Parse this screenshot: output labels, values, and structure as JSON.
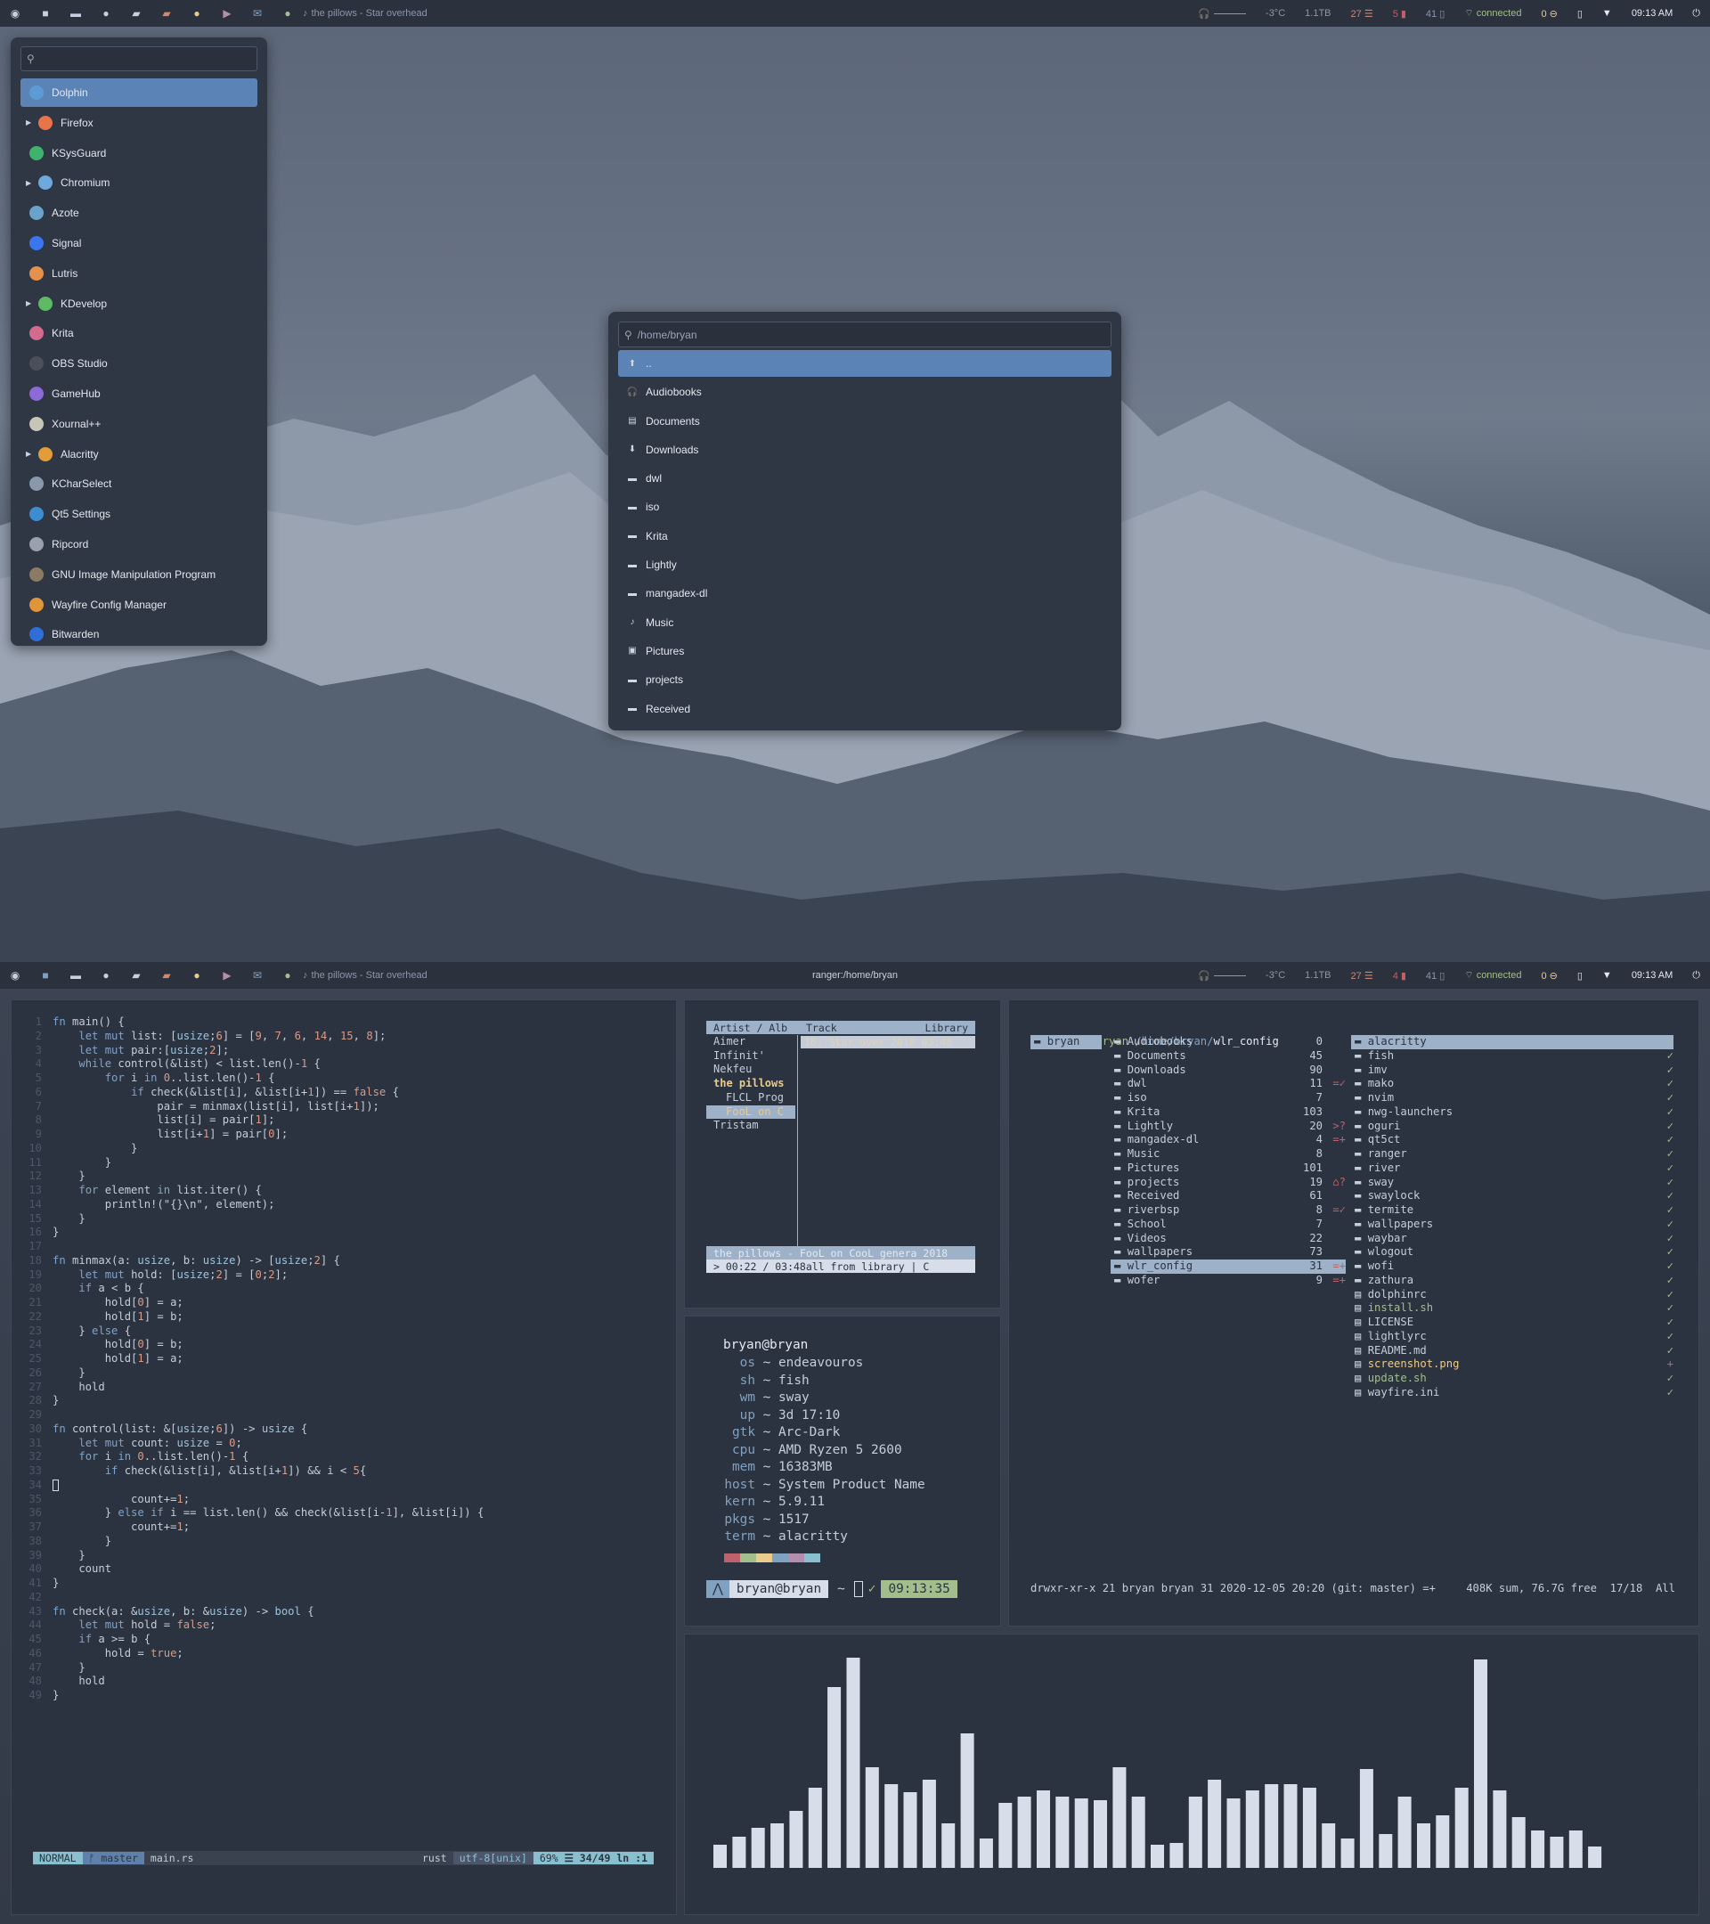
{
  "top_bar": {
    "now_playing": "the pillows - Star overhead",
    "temp": "-3°C",
    "disk": "1.1TB",
    "cpu": "27",
    "mem": "5",
    "battery": "41",
    "network": "connected",
    "notify": "0",
    "clock": "09:13 AM"
  },
  "bottom_bar": {
    "now_playing": "the pillows - Star overhead",
    "window_title": "ranger:/home/bryan",
    "temp": "-3°C",
    "disk": "1.1TB",
    "cpu": "27",
    "mem": "4",
    "battery": "41",
    "network": "connected",
    "notify": "0",
    "clock": "09:13 AM"
  },
  "launcher": {
    "items": [
      {
        "label": "Dolphin",
        "color": "#5c9bd6",
        "selected": true,
        "expandable": false
      },
      {
        "label": "Firefox",
        "color": "#e8744a",
        "expandable": true
      },
      {
        "label": "KSysGuard",
        "color": "#3fb36b",
        "expandable": false
      },
      {
        "label": "Chromium",
        "color": "#6fa8dc",
        "expandable": true
      },
      {
        "label": "Azote",
        "color": "#6aa3c9",
        "expandable": false
      },
      {
        "label": "Signal",
        "color": "#3a76f0",
        "expandable": false
      },
      {
        "label": "Lutris",
        "color": "#e6904b",
        "expandable": false
      },
      {
        "label": "KDevelop",
        "color": "#5dbb63",
        "expandable": true
      },
      {
        "label": "Krita",
        "color": "#d46a8c",
        "expandable": false
      },
      {
        "label": "OBS Studio",
        "color": "#4a4f5a",
        "expandable": false
      },
      {
        "label": "GameHub",
        "color": "#8e6ad6",
        "expandable": false
      },
      {
        "label": "Xournal++",
        "color": "#c8c4b8",
        "expandable": false
      },
      {
        "label": "Alacritty",
        "color": "#e39c3a",
        "expandable": true
      },
      {
        "label": "KCharSelect",
        "color": "#8a98ad",
        "expandable": false
      },
      {
        "label": "Qt5 Settings",
        "color": "#3d8ed0",
        "expandable": false
      },
      {
        "label": "Ripcord",
        "color": "#9aa1ad",
        "expandable": false
      },
      {
        "label": "GNU Image Manipulation Program",
        "color": "#8c7b63",
        "expandable": false
      },
      {
        "label": "Wayfire Config Manager",
        "color": "#e0953a",
        "expandable": false
      },
      {
        "label": "Bitwarden",
        "color": "#2f6ed6",
        "expandable": false
      }
    ]
  },
  "picker": {
    "placeholder": "/home/bryan",
    "items": [
      {
        "label": "..",
        "icon": "arrow-up-icon",
        "glyph": "⬆",
        "selected": true
      },
      {
        "label": "Audiobooks",
        "icon": "headphones-icon",
        "glyph": "🎧"
      },
      {
        "label": "Documents",
        "icon": "document-icon",
        "glyph": "▤"
      },
      {
        "label": "Downloads",
        "icon": "download-icon",
        "glyph": "⬇"
      },
      {
        "label": "dwl",
        "icon": "folder-icon",
        "glyph": "▬"
      },
      {
        "label": "iso",
        "icon": "folder-icon",
        "glyph": "▬"
      },
      {
        "label": "Krita",
        "icon": "folder-icon",
        "glyph": "▬"
      },
      {
        "label": "Lightly",
        "icon": "folder-icon",
        "glyph": "▬"
      },
      {
        "label": "mangadex-dl",
        "icon": "folder-icon",
        "glyph": "▬"
      },
      {
        "label": "Music",
        "icon": "music-icon",
        "glyph": "♪"
      },
      {
        "label": "Pictures",
        "icon": "image-icon",
        "glyph": "▣"
      },
      {
        "label": "projects",
        "icon": "folder-icon",
        "glyph": "▬"
      },
      {
        "label": "Received",
        "icon": "folder-icon",
        "glyph": "▬"
      }
    ]
  },
  "editor": {
    "lines": [
      "fn main() {",
      "    let mut list: [usize;6] = [9, 7, 6, 14, 15, 8];",
      "    let mut pair:[usize;2];",
      "    while control(&list) < list.len()-1 {",
      "        for i in 0..list.len()-1 {",
      "            if check(&list[i], &list[i+1]) == false {",
      "                pair = minmax(list[i], list[i+1]);",
      "                list[i] = pair[1];",
      "                list[i+1] = pair[0];",
      "            }",
      "        }",
      "    }",
      "    for element in list.iter() {",
      "        println!(\"{}\\n\", element);",
      "    }",
      "}",
      "",
      "fn minmax(a: usize, b: usize) -> [usize;2] {",
      "    let mut hold: [usize;2] = [0;2];",
      "    if a < b {",
      "        hold[0] = a;",
      "        hold[1] = b;",
      "    } else {",
      "        hold[0] = b;",
      "        hold[1] = a;",
      "    }",
      "    hold",
      "}",
      "",
      "fn control(list: &[usize;6]) -> usize {",
      "    let mut count: usize = 0;",
      "    for i in 0..list.len()-1 {",
      "        if check(&list[i], &list[i+1]) && i < 5{",
      "",
      "            count+=1;",
      "        } else if i == list.len() && check(&list[i-1], &list[i]) {",
      "            count+=1;",
      "        }",
      "    }",
      "    count",
      "}",
      "",
      "fn check(a: &usize, b: &usize) -> bool {",
      "    let mut hold = false;",
      "    if a >= b {",
      "        hold = true;",
      "    }",
      "    hold",
      "}"
    ],
    "status": {
      "mode": "NORMAL",
      "branch": "ᚠ master",
      "file": "main.rs",
      "filetype": "rust",
      "encoding": "utf-8[unix]",
      "percent": "69%",
      "position": "☰ 34/49",
      "col": "ln :1"
    }
  },
  "cmus": {
    "headers": {
      "artist": "Artist / Alb",
      "track": "Track",
      "library": "Library"
    },
    "artists": [
      "Aimer",
      "Infinit'",
      "Nekfeu",
      "the pillows",
      "FLCL Prog",
      "FooL on C",
      "Tristam"
    ],
    "track": "16. Star over 2018 03:48",
    "now_playing": "the pillows - FooL on CooL genera 2018",
    "progress": "> 00:22 / 03:48all from library | C"
  },
  "fetch": {
    "user": "bryan@bryan",
    "rows": [
      {
        "key": "os",
        "value": "endeavouros"
      },
      {
        "key": "sh",
        "value": "fish"
      },
      {
        "key": "wm",
        "value": "sway"
      },
      {
        "key": "up",
        "value": "3d 17:10"
      },
      {
        "key": "gtk",
        "value": "Arc-Dark"
      },
      {
        "key": "cpu",
        "value": "AMD Ryzen 5 2600"
      },
      {
        "key": "mem",
        "value": "16383MB"
      },
      {
        "key": "host",
        "value": "System Product Name"
      },
      {
        "key": "kern",
        "value": "5.9.11"
      },
      {
        "key": "pkgs",
        "value": "1517"
      },
      {
        "key": "term",
        "value": "alacritty"
      }
    ],
    "palette": [
      "#bf616a",
      "#a3be8c",
      "#ebcb8b",
      "#81a1c1",
      "#b48ead",
      "#88c0d0"
    ],
    "prompt_user": "bryan@bryan",
    "prompt_dir": "~",
    "prompt_time": "09:13:35"
  },
  "ranger": {
    "path_user": "bryan@bryan",
    "path_dir": "/home/bryan/",
    "path_current": "wlr_config",
    "parent": "bryan",
    "middle": [
      {
        "name": "Audiobooks",
        "size": "0",
        "git": ""
      },
      {
        "name": "Documents",
        "size": "45",
        "git": ""
      },
      {
        "name": "Downloads",
        "size": "90",
        "git": ""
      },
      {
        "name": "dwl",
        "size": "11",
        "git": "=✓"
      },
      {
        "name": "iso",
        "size": "7",
        "git": ""
      },
      {
        "name": "Krita",
        "size": "103",
        "git": ""
      },
      {
        "name": "Lightly",
        "size": "20",
        "git": ">?"
      },
      {
        "name": "mangadex-dl",
        "size": "4",
        "git": "=+"
      },
      {
        "name": "Music",
        "size": "8",
        "git": ""
      },
      {
        "name": "Pictures",
        "size": "101",
        "git": ""
      },
      {
        "name": "projects",
        "size": "19",
        "git": "⌂?"
      },
      {
        "name": "Received",
        "size": "61",
        "git": ""
      },
      {
        "name": "riverbsp",
        "size": "8",
        "git": "=✓"
      },
      {
        "name": "School",
        "size": "7",
        "git": ""
      },
      {
        "name": "Videos",
        "size": "22",
        "git": ""
      },
      {
        "name": "wallpapers",
        "size": "73",
        "git": ""
      },
      {
        "name": "wlr_config",
        "size": "31",
        "git": "=+"
      },
      {
        "name": "wofer",
        "size": "9",
        "git": "=+"
      }
    ],
    "right": [
      {
        "name": "alacritty",
        "mark": "✓"
      },
      {
        "name": "fish",
        "mark": "✓"
      },
      {
        "name": "imv",
        "mark": "✓"
      },
      {
        "name": "mako",
        "mark": "✓"
      },
      {
        "name": "nvim",
        "mark": "✓"
      },
      {
        "name": "nwg-launchers",
        "mark": "✓"
      },
      {
        "name": "oguri",
        "mark": "✓"
      },
      {
        "name": "qt5ct",
        "mark": "✓"
      },
      {
        "name": "ranger",
        "mark": "✓"
      },
      {
        "name": "river",
        "mark": "✓"
      },
      {
        "name": "sway",
        "mark": "✓"
      },
      {
        "name": "swaylock",
        "mark": "✓"
      },
      {
        "name": "termite",
        "mark": "✓"
      },
      {
        "name": "wallpapers",
        "mark": "✓"
      },
      {
        "name": "waybar",
        "mark": "✓"
      },
      {
        "name": "wlogout",
        "mark": "✓"
      },
      {
        "name": "wofi",
        "mark": "✓"
      },
      {
        "name": "zathura",
        "mark": "✓"
      },
      {
        "name": "dolphinrc",
        "mark": "✓"
      },
      {
        "name": "install.sh",
        "mark": "✓"
      },
      {
        "name": "LICENSE",
        "mark": "✓"
      },
      {
        "name": "lightlyrc",
        "mark": "✓"
      },
      {
        "name": "README.md",
        "mark": "✓"
      },
      {
        "name": "screenshot.png",
        "mark": "+"
      },
      {
        "name": "update.sh",
        "mark": "✓"
      },
      {
        "name": "wayfire.ini",
        "mark": "✓"
      }
    ],
    "footer": "drwxr-xr-x 21 bryan bryan 31 2020-12-05 20:20 (git: master) =+",
    "footer_right": "408K sum, 76.7G free  17/18  All"
  },
  "visualizer": {
    "levels": [
      0.11,
      0.15,
      0.19,
      0.21,
      0.27,
      0.38,
      0.86,
      1.0,
      0.48,
      0.4,
      0.36,
      0.42,
      0.21,
      0.64,
      0.14,
      0.31,
      0.34,
      0.37,
      0.34,
      0.33,
      0.32,
      0.48,
      0.34,
      0.11,
      0.12,
      0.34,
      0.42,
      0.33,
      0.37,
      0.4,
      0.4,
      0.38,
      0.21,
      0.14,
      0.47,
      0.16,
      0.34,
      0.21,
      0.25,
      0.38,
      0.99,
      0.37,
      0.24,
      0.18,
      0.15,
      0.18,
      0.1
    ]
  }
}
